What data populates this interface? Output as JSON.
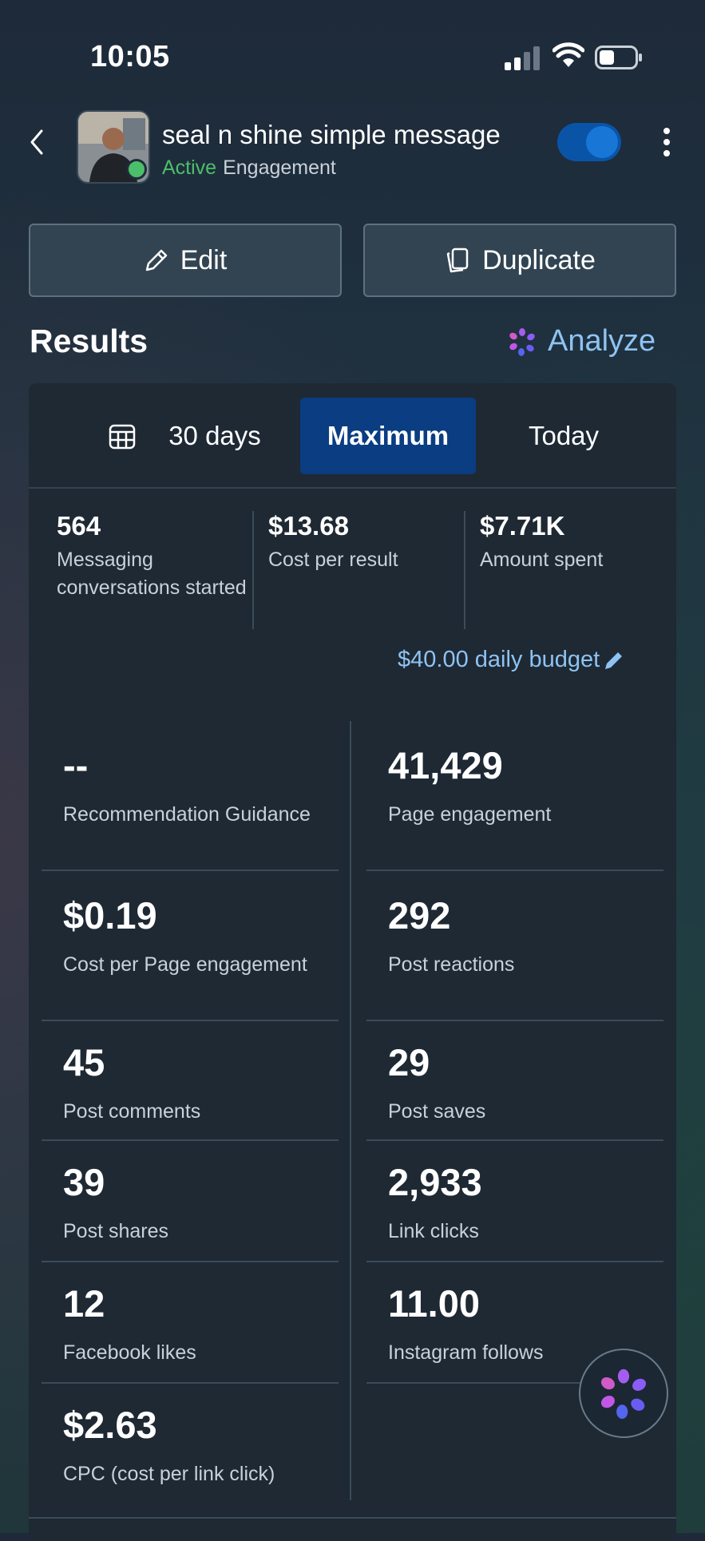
{
  "status_bar": {
    "time": "10:05"
  },
  "header": {
    "title": "seal n shine simple message",
    "status": "Active",
    "objective": "Engagement"
  },
  "actions": {
    "edit_label": "Edit",
    "duplicate_label": "Duplicate"
  },
  "results": {
    "title": "Results",
    "analyze_label": "Analyze",
    "tabs": [
      {
        "label": "30 days",
        "selected": false
      },
      {
        "label": "Maximum",
        "selected": true
      },
      {
        "label": "Today",
        "selected": false
      }
    ],
    "summary": [
      {
        "value": "564",
        "label": "Messaging conversations started"
      },
      {
        "value": "$13.68",
        "label": "Cost per result"
      },
      {
        "value": "$7.71K",
        "label": "Amount spent"
      }
    ],
    "budget_label": "$40.00 daily budget",
    "metrics_left": [
      {
        "value": "--",
        "label": "Recommendation Guidance"
      },
      {
        "value": "$0.19",
        "label": "Cost per Page engagement"
      },
      {
        "value": "45",
        "label": "Post comments"
      },
      {
        "value": "39",
        "label": "Post shares"
      },
      {
        "value": "12",
        "label": "Facebook likes"
      },
      {
        "value": "$2.63",
        "label": "CPC (cost per link click)"
      }
    ],
    "metrics_right": [
      {
        "value": "41,429",
        "label": "Page engagement"
      },
      {
        "value": "292",
        "label": "Post reactions"
      },
      {
        "value": "29",
        "label": "Post saves"
      },
      {
        "value": "2,933",
        "label": "Link clicks"
      },
      {
        "value": "11.00",
        "label": "Instagram follows"
      }
    ]
  },
  "colors": {
    "accent_blue": "#8ec3f2",
    "selected_tab": "#0a3d82",
    "active_green": "#4cbf6a",
    "toggle_on": "#1877d6"
  },
  "icons": [
    "back-icon",
    "signal-icon",
    "wifi-icon",
    "battery-icon",
    "more-vertical-icon",
    "pencil-icon",
    "duplicate-icon",
    "sparkle-icon",
    "calendar-icon",
    "ai-assistant-icon"
  ]
}
